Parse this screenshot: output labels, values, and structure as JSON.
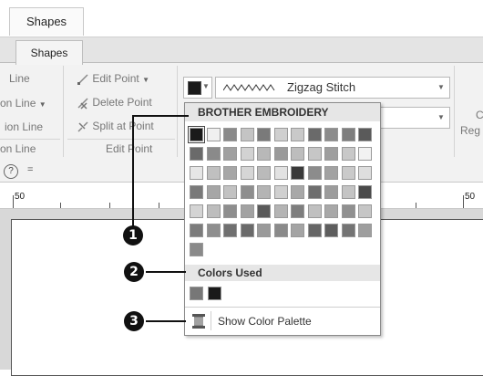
{
  "window": {
    "title_tab": "Shapes"
  },
  "ribbon": {
    "active_tab": "Shapes",
    "line_group": {
      "items": [
        "Line",
        "on Line",
        "ion Line"
      ],
      "label": "on Line"
    },
    "edit_point_group": {
      "items": [
        "Edit Point",
        "Delete Point",
        "Split at Point"
      ],
      "label": "Edit Point"
    },
    "stitch_combo": {
      "value": "Zigzag Stitch"
    },
    "right_partial": {
      "c_text": "C",
      "reg_text": "Reg"
    }
  },
  "quick_access": {
    "help": "?",
    "customize": "="
  },
  "ruler": {
    "left_number": "50",
    "right_number": "50"
  },
  "color_dropdown": {
    "header": "BROTHER EMBROIDERY",
    "palette": [
      [
        "#1a1a1a",
        "#f0f0f0",
        "#8a8a8a",
        "#c4c4c4",
        "#7a7a7a",
        "#cfcfcf",
        "#c9c9c9",
        "#6a6a6a",
        "#8c8c8c",
        "#7e7e7e",
        "#5a5a5a"
      ],
      [
        "#6a6a6a",
        "#8a8a8a",
        "#a0a0a0",
        "#d2d2d2",
        "#b8b8b8",
        "#9a9a9a",
        "#bdbdbd",
        "#c6c6c6",
        "#9e9e9e",
        "#c8c8c8",
        "#f2f2f2"
      ],
      [
        "#e6e6e6",
        "#c0c0c0",
        "#a6a6a6",
        "#d6d6d6",
        "#bababa",
        "#e2e2e2",
        "#3a3a3a",
        "#8c8c8c",
        "#a2a2a2",
        "#cacaca",
        "#dedede"
      ],
      [
        "#7a7a7a",
        "#a6a6a6",
        "#c2c2c2",
        "#8e8e8e",
        "#b4b4b4",
        "#d0d0d0",
        "#a8a8a8",
        "#6e6e6e",
        "#9c9c9c",
        "#c4c4c4",
        "#4a4a4a"
      ],
      [
        "#d4d4d4",
        "#bdbdbd",
        "#8e8e8e",
        "#a2a2a2",
        "#5a5a5a",
        "#b4b4b4",
        "#7e7e7e",
        "#c0c0c0",
        "#a8a8a8",
        "#909090",
        "#c6c6c6"
      ],
      [
        "#7c7c7c",
        "#8e8e8e",
        "#707070",
        "#6a6a6a",
        "#9a9a9a",
        "#8a8a8a",
        "#a4a4a4",
        "#666666",
        "#5e5e5e",
        "#747474",
        "#9e9e9e"
      ],
      [
        "#8a8a8a"
      ]
    ],
    "colors_used_label": "Colors Used",
    "colors_used": [
      "#777777",
      "#1a1a1a"
    ],
    "show_palette_label": "Show Color Palette"
  },
  "callouts": [
    "1",
    "2",
    "3"
  ]
}
